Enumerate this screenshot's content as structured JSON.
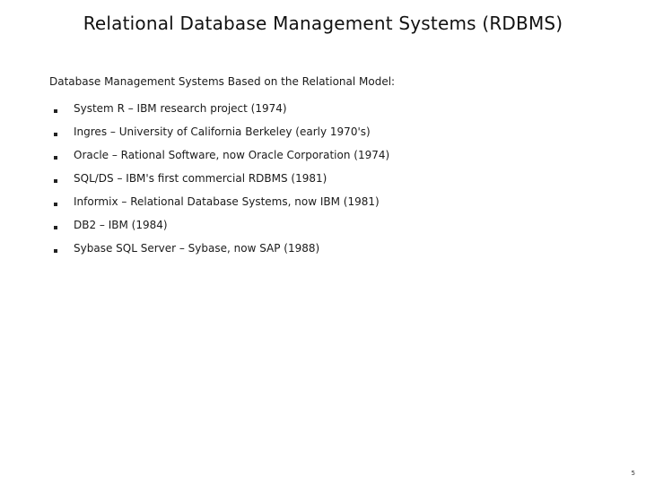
{
  "slide": {
    "title": "Relational Database Management Systems (RDBMS)",
    "intro": "Database Management Systems Based on the Relational Model:",
    "bullets": [
      "System R – IBM research project (1974)",
      "Ingres – University of California Berkeley (early 1970's)",
      "Oracle – Rational Software, now Oracle Corporation (1974)",
      "SQL/DS – IBM's first commercial RDBMS (1981)",
      "Informix – Relational Database Systems, now IBM (1981)",
      "DB2 – IBM (1984)",
      "Sybase SQL Server – Sybase, now SAP (1988)"
    ],
    "page_number": "5"
  }
}
